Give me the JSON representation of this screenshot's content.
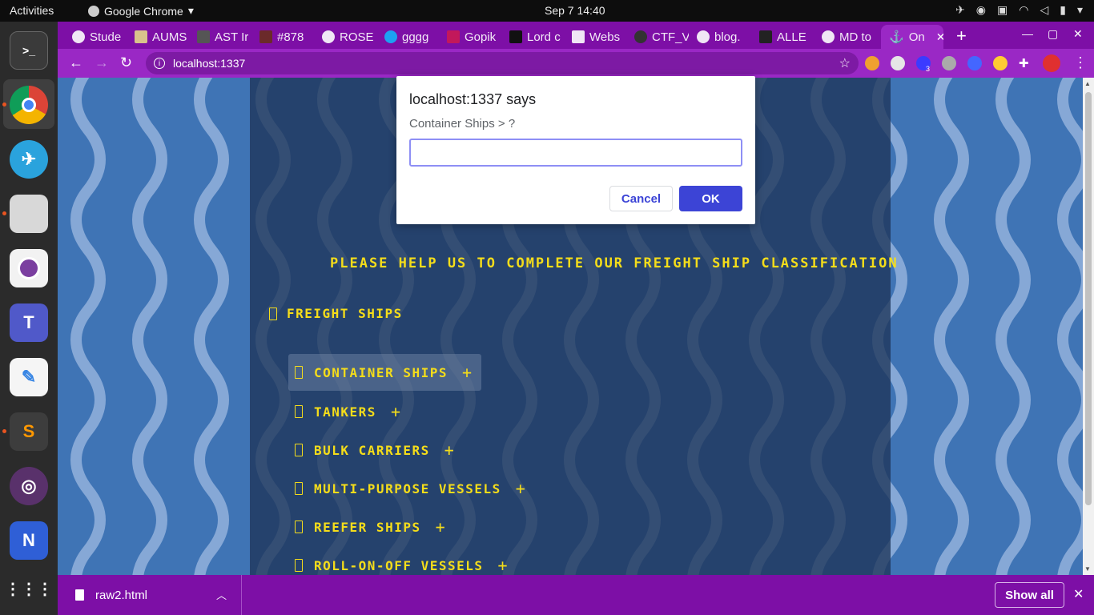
{
  "topbar": {
    "activities": "Activities",
    "app_name": "Google Chrome",
    "clock": "Sep 7  14:40"
  },
  "tabs": [
    {
      "label": "Stude"
    },
    {
      "label": "AUMS"
    },
    {
      "label": "AST Ir"
    },
    {
      "label": "#878"
    },
    {
      "label": "ROSE"
    },
    {
      "label": "gggg"
    },
    {
      "label": "Gopik"
    },
    {
      "label": "Lord c"
    },
    {
      "label": "Webs"
    },
    {
      "label": "CTF_V"
    },
    {
      "label": "blog."
    },
    {
      "label": "ALLE"
    },
    {
      "label": "MD to"
    },
    {
      "label": "On"
    }
  ],
  "toolbar": {
    "url": "localhost:1337",
    "extension_badge": "3"
  },
  "page": {
    "heading": "PLEASE HELP US TO COMPLETE OUR FREIGHT SHIP CLASSIFICATION",
    "root": "FREIGHT SHIPS",
    "items": [
      {
        "label": "CONTAINER SHIPS"
      },
      {
        "label": "TANKERS"
      },
      {
        "label": "BULK CARRIERS"
      },
      {
        "label": "MULTI-PURPOSE VESSELS"
      },
      {
        "label": "REEFER SHIPS"
      },
      {
        "label": "ROLL-ON-OFF VESSELS"
      }
    ]
  },
  "dialog": {
    "title": "localhost:1337 says",
    "message": "Container Ships > ?",
    "input_value": "",
    "cancel": "Cancel",
    "ok": "OK"
  },
  "downloads": {
    "file": "raw2.html",
    "show_all": "Show all"
  },
  "colors": {
    "tabstrip": "#7d0fa6",
    "toolbar": "#9a28c5",
    "page_bg": "#3f74b5",
    "text_yellow": "#f5dd1a",
    "dialog_accent": "#3c44d6"
  }
}
